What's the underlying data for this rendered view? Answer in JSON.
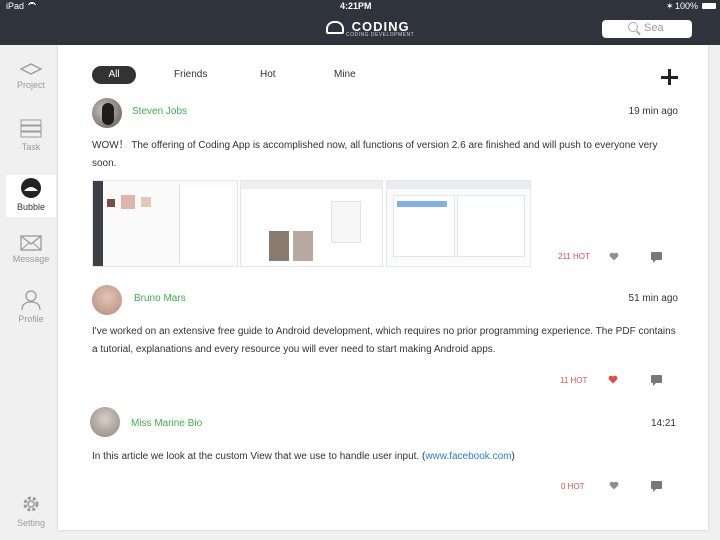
{
  "statusbar": {
    "device": "iPad",
    "time": "4:21PM",
    "battery": "100%"
  },
  "header": {
    "logo_text": "CODING",
    "logo_sub": "CODING DEVELOPMENT",
    "search_placeholder": "Search",
    "search_value": "Sea"
  },
  "sidebar": {
    "items": [
      {
        "label": "Project"
      },
      {
        "label": "Task"
      },
      {
        "label": "Bubble"
      },
      {
        "label": "Message"
      },
      {
        "label": "Profile"
      },
      {
        "label": "Setting"
      }
    ]
  },
  "tabs": [
    {
      "label": "All"
    },
    {
      "label": "Friends"
    },
    {
      "label": "Hot"
    },
    {
      "label": "Mine"
    }
  ],
  "posts": [
    {
      "author": "Steven Jobs",
      "time": "19 min ago",
      "text": "WOW！ The offering of Coding App is accomplished now, all functions of version 2.6 are finished and will push to everyone very soon.",
      "hot": "211 HOT",
      "liked": false
    },
    {
      "author": "Bruno Mars",
      "time": "51 min ago",
      "text": "I've worked on an extensive free guide to Android development, which requires no prior programming experience. The PDF contains a tutorial, explanations and every resource you will ever need to start making Android apps.",
      "hot": "11 HOT",
      "liked": true
    },
    {
      "author": "Miss Marine Bio",
      "time": "14:21",
      "text_prefix": "In this article we look at the custom View that we use to handle user input. (",
      "link": "www.facebook.com",
      "text_suffix": ")",
      "hot": "0 HOT",
      "liked": false
    }
  ],
  "colors": {
    "header_bg": "#2f333b",
    "accent_green": "#3fae49",
    "hot_red": "#e34b4b",
    "link_blue": "#2b7bd4"
  }
}
